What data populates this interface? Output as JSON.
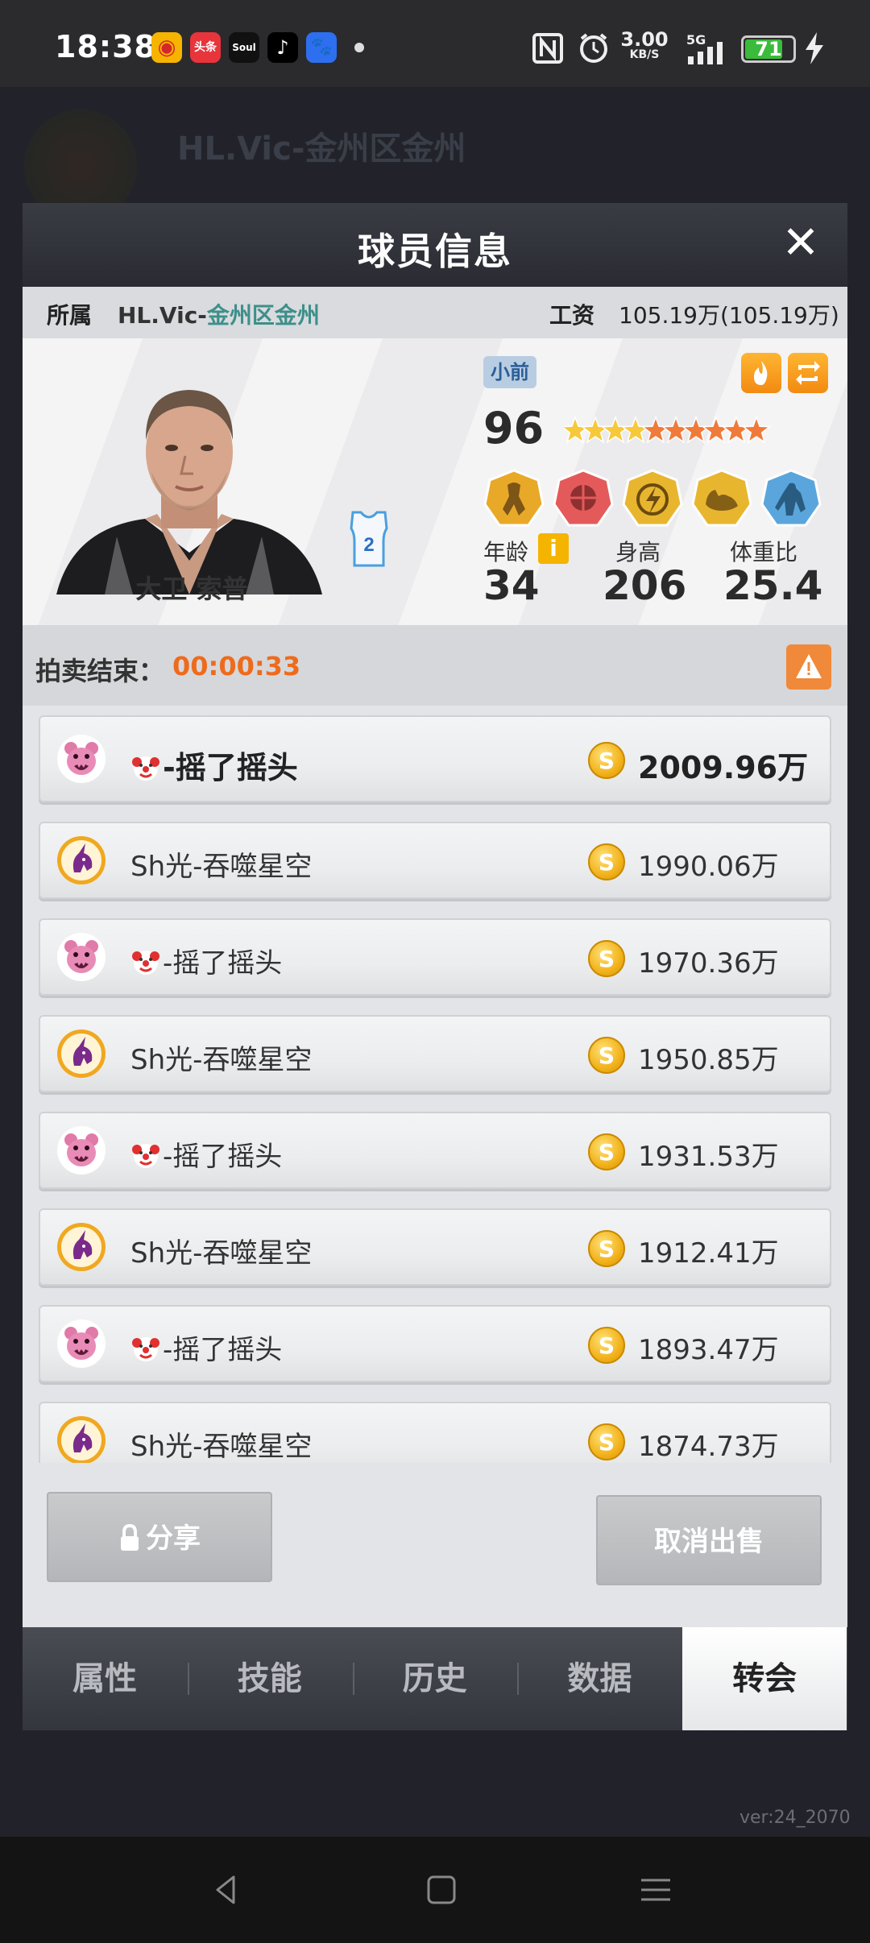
{
  "status_bar": {
    "time": "18:38",
    "apps": [
      "weibo",
      "头条",
      "Soul",
      "tiktok",
      "baidu"
    ],
    "speed_value": "3.00",
    "speed_unit": "KB/S",
    "network": "5G",
    "battery": "71"
  },
  "background": {
    "team_text": "HL.Vic-金州区金州"
  },
  "dialog": {
    "title": "球员信息",
    "close_label": "✕"
  },
  "info_row": {
    "team_label": "所属",
    "team_prefix": "HL.Vic-",
    "team_highlight": "金州区金州",
    "salary_label": "工资",
    "salary_value": "105.19万(105.19万)"
  },
  "player": {
    "name": "大卫 索普",
    "jersey_number": "2",
    "position": "小前",
    "overall": "96",
    "stars": 10,
    "skills": [
      "post-up-icon",
      "dunk-icon",
      "speed-icon",
      "strength-icon",
      "defense-icon"
    ],
    "age_label": "年龄",
    "age": "34",
    "info_icon": "i",
    "height_label": "身高",
    "height": "206",
    "weight_ratio_label": "体重比",
    "weight_ratio": "25.4"
  },
  "auction": {
    "label": "拍卖结束：",
    "timer": "00:00:33"
  },
  "bids": [
    {
      "bidder": "-摇了摇头",
      "clown": true,
      "team": "bear",
      "price": "2009.96万",
      "top": true
    },
    {
      "bidder": "Sh光-吞噬星空",
      "clown": false,
      "team": "unicorn",
      "price": "1990.06万",
      "top": false
    },
    {
      "bidder": "-摇了摇头",
      "clown": true,
      "team": "bear",
      "price": "1970.36万",
      "top": false
    },
    {
      "bidder": "Sh光-吞噬星空",
      "clown": false,
      "team": "unicorn",
      "price": "1950.85万",
      "top": false
    },
    {
      "bidder": "-摇了摇头",
      "clown": true,
      "team": "bear",
      "price": "1931.53万",
      "top": false
    },
    {
      "bidder": "Sh光-吞噬星空",
      "clown": false,
      "team": "unicorn",
      "price": "1912.41万",
      "top": false
    },
    {
      "bidder": "-摇了摇头",
      "clown": true,
      "team": "bear",
      "price": "1893.47万",
      "top": false
    },
    {
      "bidder": "Sh光-吞噬星空",
      "clown": false,
      "team": "unicorn",
      "price": "1874.73万",
      "top": false
    }
  ],
  "coin_symbol": "S",
  "buttons": {
    "share": "分享",
    "cancel_sale": "取消出售"
  },
  "tabs": [
    {
      "label": "属性",
      "active": false
    },
    {
      "label": "技能",
      "active": false
    },
    {
      "label": "历史",
      "active": false
    },
    {
      "label": "数据",
      "active": false
    },
    {
      "label": "转会",
      "active": true
    }
  ],
  "version": "ver:24_2070",
  "colors": {
    "accent_orange": "#ee6b1c",
    "team_highlight": "#3d8f8a",
    "position_badge": "#2c5e98"
  }
}
